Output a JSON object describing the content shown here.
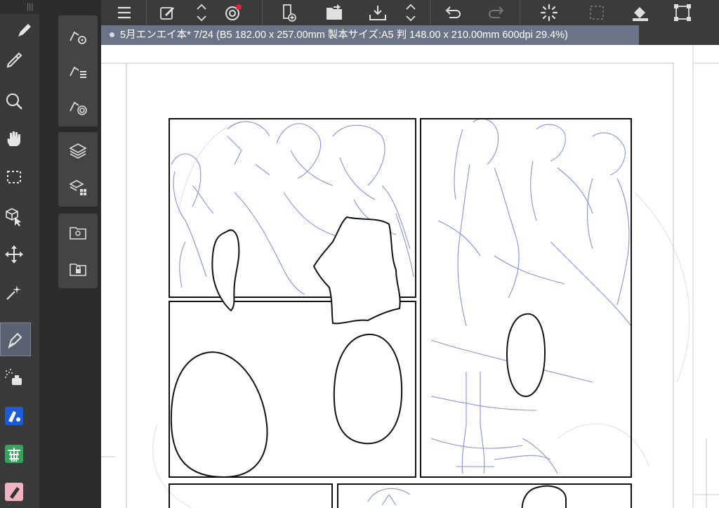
{
  "document": {
    "tab_title": "5月エンエイ本* 7/24 (B5 182.00 x 257.00mm 製本サイズ:A5 判 148.00 x 210.00mm 600dpi 29.4%)"
  },
  "toolbar_left": {
    "tools": [
      {
        "name": "pen-tool",
        "icon": "pen-icon"
      },
      {
        "name": "eyedropper-tool",
        "icon": "eyedropper-icon"
      },
      {
        "name": "zoom-tool",
        "icon": "magnifier-icon"
      },
      {
        "name": "hand-tool",
        "icon": "hand-icon"
      },
      {
        "name": "selection-tool",
        "icon": "dashed-rectangle-icon"
      },
      {
        "name": "object-tool",
        "icon": "cube-cursor-icon"
      },
      {
        "name": "move-tool",
        "icon": "move-arrows-icon"
      },
      {
        "name": "auto-select-tool",
        "icon": "magic-wand-icon"
      },
      {
        "name": "pen-nib-tool",
        "icon": "pen-nib-icon",
        "active": true
      },
      {
        "name": "airbrush-tool",
        "icon": "airbrush-icon"
      },
      {
        "name": "fill-tool",
        "icon": "paint-bucket-icon"
      },
      {
        "name": "decoration-tool",
        "icon": "leaf-pattern-icon"
      },
      {
        "name": "eraser-tool",
        "icon": "eraser-icon"
      }
    ]
  },
  "colors": {
    "accent_tab": "#6b7487",
    "toolbar_bg": "#3b3b3b",
    "sketch_blue": "#6f7fd6",
    "panel_border": "#111111"
  }
}
